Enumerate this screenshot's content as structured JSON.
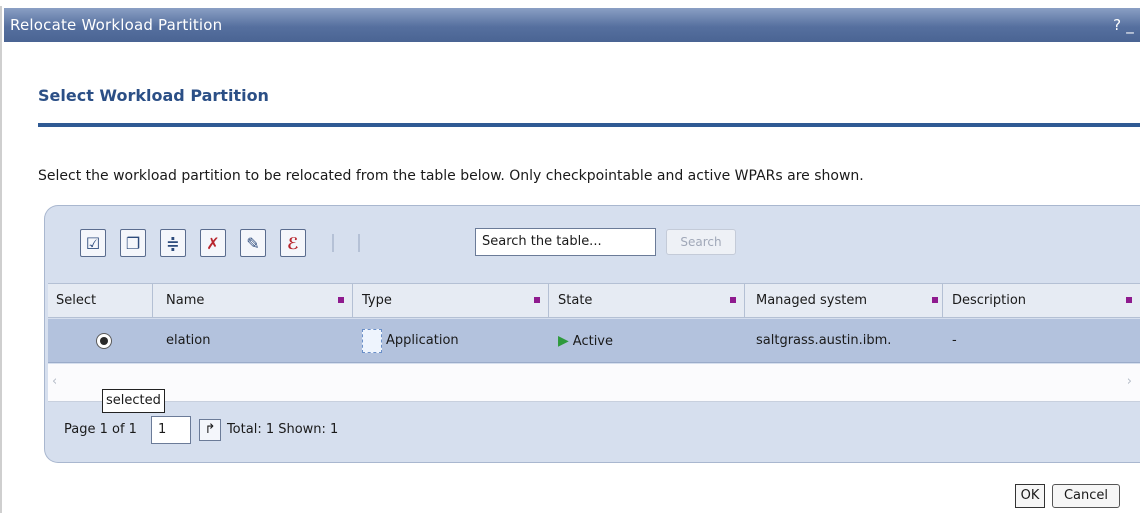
{
  "window": {
    "title": "Relocate Workload Partition",
    "controls": "? _"
  },
  "page": {
    "heading": "Select Workload Partition",
    "description": "Select the workload partition to be relocated from the table below. Only checkpointable and active WPARs are shown."
  },
  "toolbar": {
    "icons": [
      "select-all-icon",
      "deselect-all-icon",
      "show-filter-icon",
      "clear-filter-icon",
      "edit-sort-icon",
      "clear-sort-icon"
    ],
    "search_placeholder": "Search the table...",
    "search_button": "Search"
  },
  "table": {
    "columns": [
      "Select",
      "Name",
      "Type",
      "State",
      "Managed system",
      "Description"
    ],
    "rows": [
      {
        "name": "elation",
        "type": "Application",
        "state": "Active",
        "managed_system": "saltgrass.austin.ibm.",
        "description": "-"
      }
    ],
    "tooltip": "selected"
  },
  "pager": {
    "page_label": "Page 1 of 1",
    "page_value": "1",
    "summary": "Total: 1 Shown: 1"
  },
  "buttons": {
    "ok": "OK",
    "cancel": "Cancel"
  },
  "colors": {
    "title_bar": "#56709f",
    "heading": "#2b4f86",
    "rule": "#2f5a94",
    "selected_row": "#b3c2dd",
    "panel": "#d6dfee"
  }
}
